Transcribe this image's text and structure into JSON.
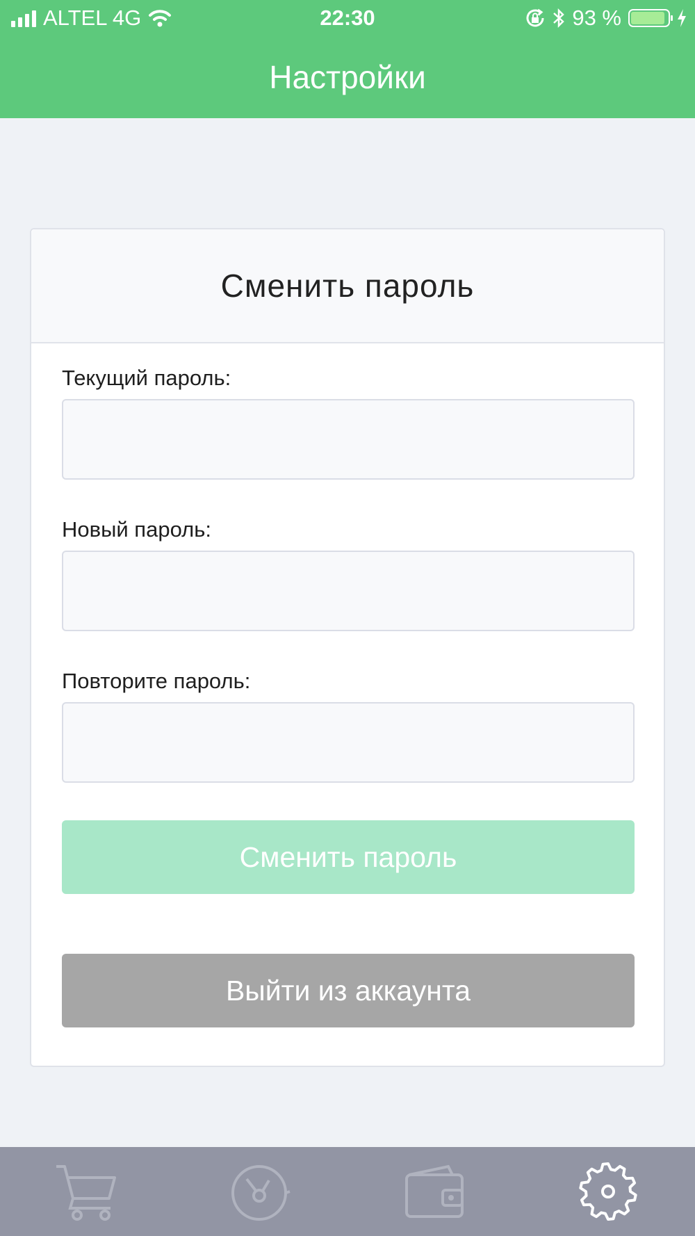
{
  "status_bar": {
    "carrier": "ALTEL 4G",
    "time": "22:30",
    "battery_percent": "93 %",
    "battery_level": 0.93,
    "icons": [
      "signal-icon",
      "wifi-icon",
      "rotation-lock-icon",
      "bluetooth-icon",
      "battery-icon",
      "charging-icon"
    ]
  },
  "nav": {
    "title": "Настройки"
  },
  "card": {
    "title": "Сменить пароль",
    "fields": [
      {
        "label": "Текущий пароль:",
        "value": "",
        "placeholder": ""
      },
      {
        "label": "Новый пароль:",
        "value": "",
        "placeholder": ""
      },
      {
        "label": "Повторите пароль:",
        "value": "",
        "placeholder": ""
      }
    ],
    "change_button": "Сменить пароль",
    "logout_button": "Выйти из аккаунта"
  },
  "tab_bar": {
    "tabs": [
      {
        "icon": "cart-icon"
      },
      {
        "icon": "timer-icon"
      },
      {
        "icon": "wallet-icon"
      },
      {
        "icon": "gear-icon",
        "active": true
      }
    ]
  },
  "colors": {
    "header": "#5dc97c",
    "background": "#eff2f6",
    "change_button": "#a8e7c8",
    "logout_button": "#a6a6a6",
    "tab_bar": "#9295a4"
  }
}
